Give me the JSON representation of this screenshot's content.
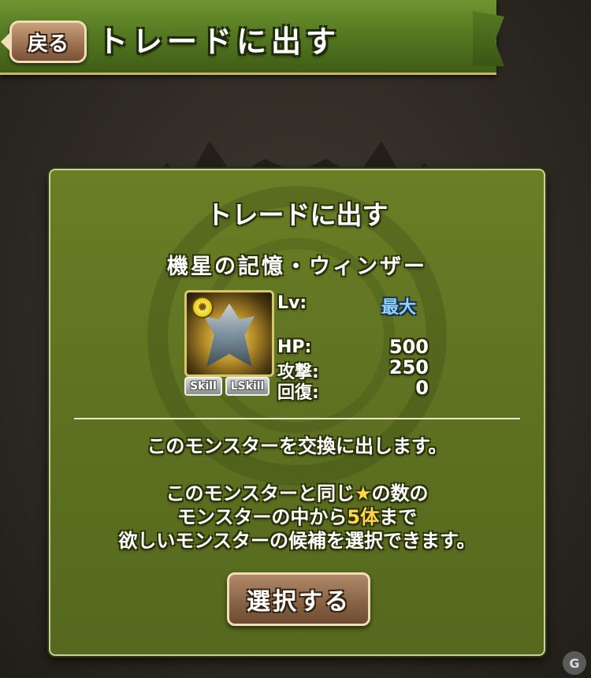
{
  "header": {
    "back_label": "戻る",
    "title": "トレードに出す"
  },
  "dialog": {
    "title": "トレードに出す",
    "monster_name": "機星の記憶・ウィンザー",
    "attribute_icon": "sun-icon",
    "skill_badges": [
      "Skill",
      "LSkill"
    ],
    "stats": {
      "level_label": "Lv:",
      "level_value": "最大",
      "hp_label": "HP:",
      "hp_value": "500",
      "attack_label": "攻撃:",
      "attack_value": "250",
      "recovery_label": "回復:",
      "recovery_value": "0"
    },
    "message_line1": "このモンスターを交換に出します。",
    "message_line2_pre": "このモンスターと同じ",
    "message_line2_star": "★",
    "message_line2_post": "の数の",
    "message_line3_pre": "モンスターの中から",
    "message_line3_count": "5体",
    "message_line3_post": "まで",
    "message_line4": "欲しいモンスターの候補を選択できます。",
    "select_label": "選択する"
  },
  "watermark": {
    "text": "G"
  },
  "colors": {
    "header_green": "#567a22",
    "dialog_green": "#5e7121",
    "button_brown": "#8a6447",
    "level_blue": "#8fd3ff",
    "accent_gold": "#ffd54a"
  }
}
